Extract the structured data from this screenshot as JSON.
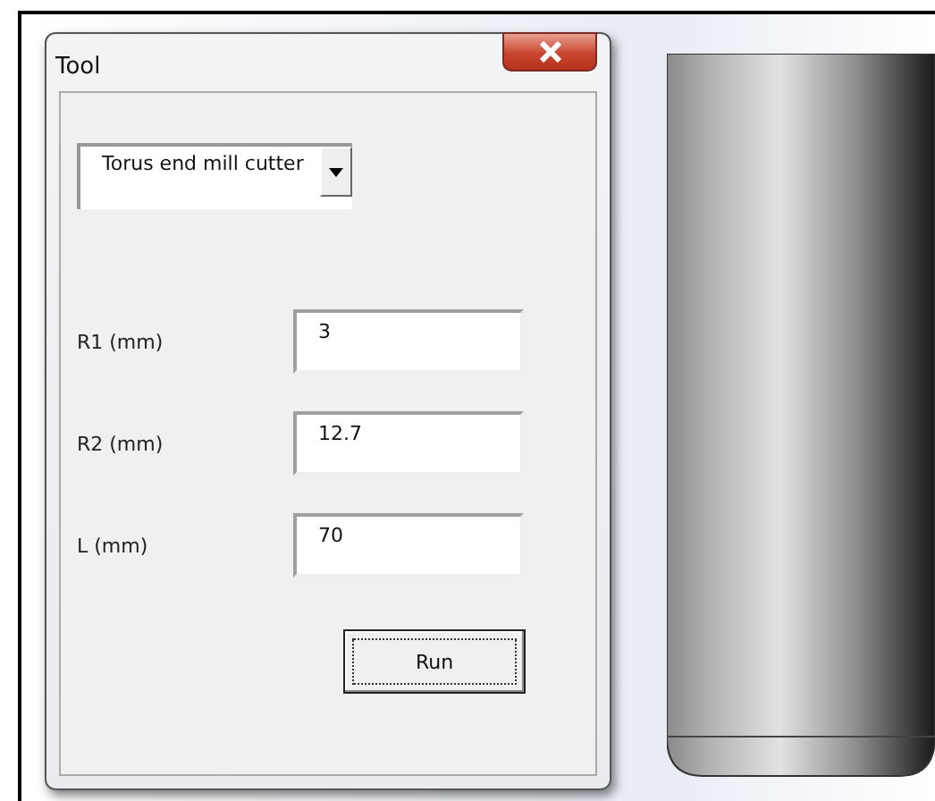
{
  "window": {
    "title": "Tool"
  },
  "tool_type": {
    "value": "Torus end mill cutter"
  },
  "fields": [
    {
      "label": "R1 (mm)",
      "value": "3"
    },
    {
      "label": "R2 (mm)",
      "value": "12.7"
    },
    {
      "label": "L (mm)",
      "value": "70"
    }
  ],
  "run_button": {
    "label": "Run"
  }
}
